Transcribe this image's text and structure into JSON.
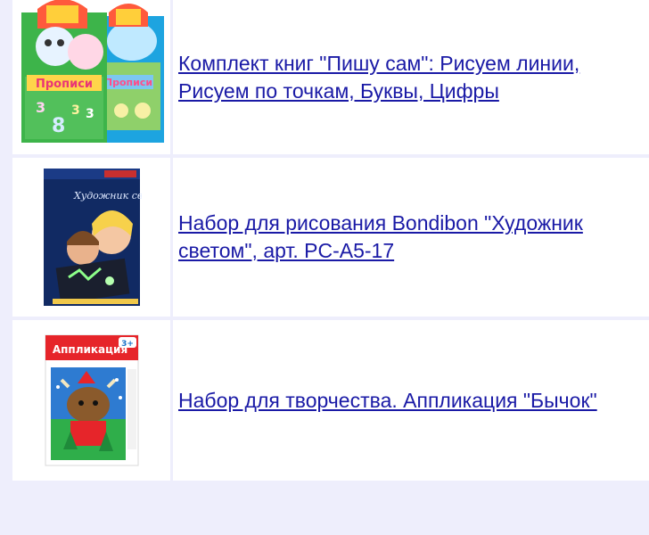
{
  "products": [
    {
      "title": "Комплект книг \"Пишу сам\": Рисуем линии, Рисуем по точкам, Буквы, Цифры",
      "image_label": "Прописи",
      "image_label_secondary": "Прописи"
    },
    {
      "title": "Набор для рисования Bondibon \"Художник светом\", арт. PC-A5-17",
      "image_label": "Художник светом"
    },
    {
      "title": "Набор для творчества. Аппликация \"Бычок\"",
      "image_label": "Аппликация",
      "age_badge": "3+"
    }
  ],
  "colors": {
    "link": "#1a1aa6",
    "page_background": "#eeeefc",
    "cell_background": "#ffffff"
  }
}
